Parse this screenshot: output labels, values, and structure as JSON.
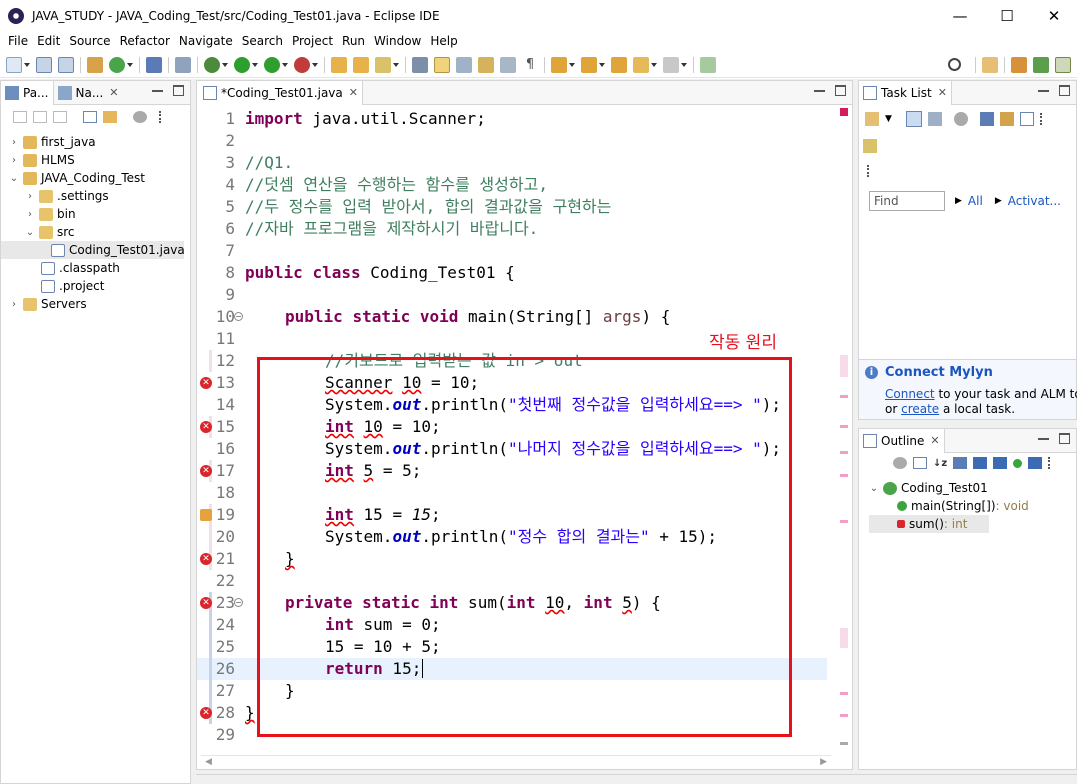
{
  "window": {
    "title": "JAVA_STUDY - JAVA_Coding_Test/src/Coding_Test01.java - Eclipse IDE",
    "minimize": "—",
    "maximize": "☐",
    "close": "✕"
  },
  "menu": [
    "File",
    "Edit",
    "Source",
    "Refactor",
    "Navigate",
    "Search",
    "Project",
    "Run",
    "Window",
    "Help"
  ],
  "explorer": {
    "tabs": [
      {
        "label": "Pa..."
      },
      {
        "label": "Na..."
      }
    ],
    "tree": [
      {
        "label": "first_java",
        "level": 0,
        "arrow": "›",
        "icon": "project"
      },
      {
        "label": "HLMS",
        "level": 0,
        "arrow": "›",
        "icon": "project"
      },
      {
        "label": "JAVA_Coding_Test",
        "level": 0,
        "arrow": "⌄",
        "icon": "project"
      },
      {
        "label": ".settings",
        "level": 1,
        "arrow": "›",
        "icon": "folder"
      },
      {
        "label": "bin",
        "level": 1,
        "arrow": "›",
        "icon": "folder"
      },
      {
        "label": "src",
        "level": 1,
        "arrow": "⌄",
        "icon": "folder"
      },
      {
        "label": "Coding_Test01.java",
        "level": 2,
        "arrow": "",
        "icon": "java",
        "selected": true
      },
      {
        "label": ".classpath",
        "level": 1,
        "arrow": "",
        "icon": "xml"
      },
      {
        "label": ".project",
        "level": 1,
        "arrow": "",
        "icon": "xml"
      },
      {
        "label": "Servers",
        "level": 0,
        "arrow": "›",
        "icon": "folder"
      }
    ]
  },
  "editor": {
    "tab_label": "*Coding_Test01.java",
    "annotation": "작동 원리",
    "lines": [
      {
        "n": "1"
      },
      {
        "n": "2"
      },
      {
        "n": "3"
      },
      {
        "n": "4"
      },
      {
        "n": "5"
      },
      {
        "n": "6"
      },
      {
        "n": "7"
      },
      {
        "n": "8"
      },
      {
        "n": "9"
      },
      {
        "n": "10"
      },
      {
        "n": "11"
      },
      {
        "n": "12"
      },
      {
        "n": "13"
      },
      {
        "n": "14"
      },
      {
        "n": "15"
      },
      {
        "n": "16"
      },
      {
        "n": "17"
      },
      {
        "n": "18"
      },
      {
        "n": "19"
      },
      {
        "n": "20"
      },
      {
        "n": "21"
      },
      {
        "n": "22"
      },
      {
        "n": "23"
      },
      {
        "n": "24"
      },
      {
        "n": "25"
      },
      {
        "n": "26"
      },
      {
        "n": "27"
      },
      {
        "n": "28"
      },
      {
        "n": "29"
      }
    ],
    "code": {
      "l1a": "import",
      "l1b": " java.util.Scanner;",
      "l3": "//Q1.",
      "l4": "//덧셈 연산을 수행하는 함수를 생성하고,",
      "l5": "//두 정수를 입력 받아서, 합의 결과값을 구현하는",
      "l6": "//자바 프로그램을 제작하시기 바랍니다.",
      "l8a": "public",
      "l8b": "class",
      "l8c": " Coding_Test01 {",
      "l10a": "public",
      "l10b": "static",
      "l10c": "void",
      "l10d": " main(String[] ",
      "l10e": "args",
      "l10f": ") {",
      "l12": "//키보드로 입력받는 값 in > out",
      "l13a": "Scanner",
      "l13b": "10",
      "l13c": " = 10;",
      "l14a": "System.",
      "l14b": "out",
      "l14c": ".println(",
      "l14d": "\"첫번째 정수값을 입력하세요==> \"",
      "l14e": ");",
      "l15a": "int",
      "l15b": "10",
      "l15c": " = 10;",
      "l16a": "System.",
      "l16b": "out",
      "l16c": ".println(",
      "l16d": "\"나머지 정수값을 입력하세요==> \"",
      "l16e": ");",
      "l17a": "int",
      "l17b": "5",
      "l17c": " = 5;",
      "l19a": "int",
      "l19b": " 15 = ",
      "l19c": "15",
      "l19d": ";",
      "l20a": "System.",
      "l20b": "out",
      "l20c": ".println(",
      "l20d": "\"정수 합의 결과는\"",
      "l20e": " + 15);",
      "l21": "}",
      "l23a": "private",
      "l23b": "static",
      "l23c": "int",
      "l23d": " sum(",
      "l23e": "int",
      "l23f": "10",
      "l23g": ", ",
      "l23h": "int",
      "l23i": "5",
      "l23j": ") {",
      "l24a": "int",
      "l24b": " sum = 0;",
      "l25": "15 = 10 + 5;",
      "l26a": "return",
      "l26b": " 15;",
      "l27": "}",
      "l28": "}"
    }
  },
  "tasklist": {
    "tab_label": "Task List",
    "find_placeholder": "Find",
    "all_label": "All",
    "activate_label": "Activat...",
    "mylyn_title": "Connect Mylyn",
    "mylyn_connect": "Connect",
    "mylyn_text1": " to your task and ALM too",
    "mylyn_or": "or ",
    "mylyn_create": "create",
    "mylyn_text2": " a local task."
  },
  "outline": {
    "tab_label": "Outline",
    "class_name": "Coding_Test01",
    "method1": "main(String[])",
    "method1_type": " : void",
    "method2": "sum()",
    "method2_type": " : int"
  },
  "colors": {
    "keyword": "#7f0055",
    "comment": "#3f7f5f",
    "string": "#2a00ff",
    "field": "#0000c0",
    "annotation": "#e8101c"
  }
}
